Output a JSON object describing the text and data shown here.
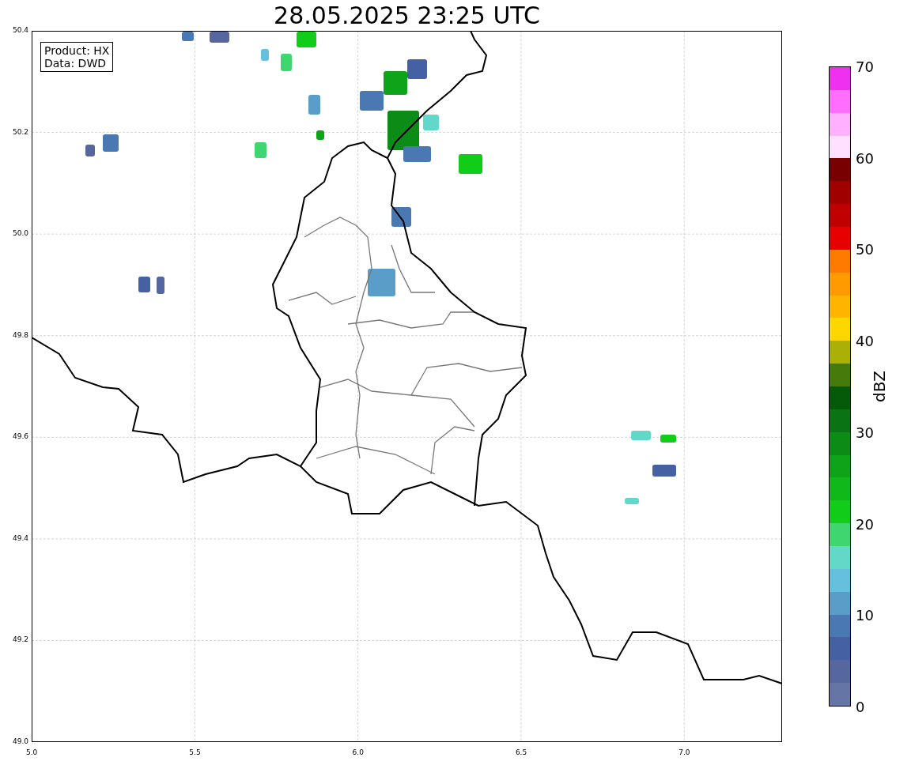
{
  "title": "28.05.2025 23:25 UTC",
  "annotation": [
    "Product: HX",
    "Data: DWD"
  ],
  "map": {
    "xticks": [
      "5.0",
      "5.5",
      "6.0",
      "6.5",
      "7.0"
    ],
    "yticks": [
      "50.4",
      "50.2",
      "50.0",
      "49.8",
      "49.6",
      "49.4",
      "49.2",
      "49.0"
    ]
  },
  "colorbar": {
    "label": "dBZ",
    "ticks": [
      "70",
      "60",
      "50",
      "40",
      "30",
      "20",
      "10",
      "0"
    ],
    "bins": [
      {
        "color": "#f030f0"
      },
      {
        "color": "#ff6eff"
      },
      {
        "color": "#ffb0ff"
      },
      {
        "color": "#ffe0ff"
      },
      {
        "color": "#780000"
      },
      {
        "color": "#a00000"
      },
      {
        "color": "#c00000"
      },
      {
        "color": "#e60000"
      },
      {
        "color": "#ff7a00"
      },
      {
        "color": "#ff9a00"
      },
      {
        "color": "#ffb400"
      },
      {
        "color": "#ffd700"
      },
      {
        "color": "#aab006"
      },
      {
        "color": "#467a0b"
      },
      {
        "color": "#055a0a"
      },
      {
        "color": "#0a7314"
      },
      {
        "color": "#0c8c16"
      },
      {
        "color": "#0ea318"
      },
      {
        "color": "#10b81a"
      },
      {
        "color": "#12cc1a"
      },
      {
        "color": "#40d66f"
      },
      {
        "color": "#62d8c8"
      },
      {
        "color": "#64c0dc"
      },
      {
        "color": "#5a9dc8"
      },
      {
        "color": "#4a78b2"
      },
      {
        "color": "#4560a3"
      },
      {
        "color": "#5667a0"
      },
      {
        "color": "#6475a6"
      }
    ]
  }
}
